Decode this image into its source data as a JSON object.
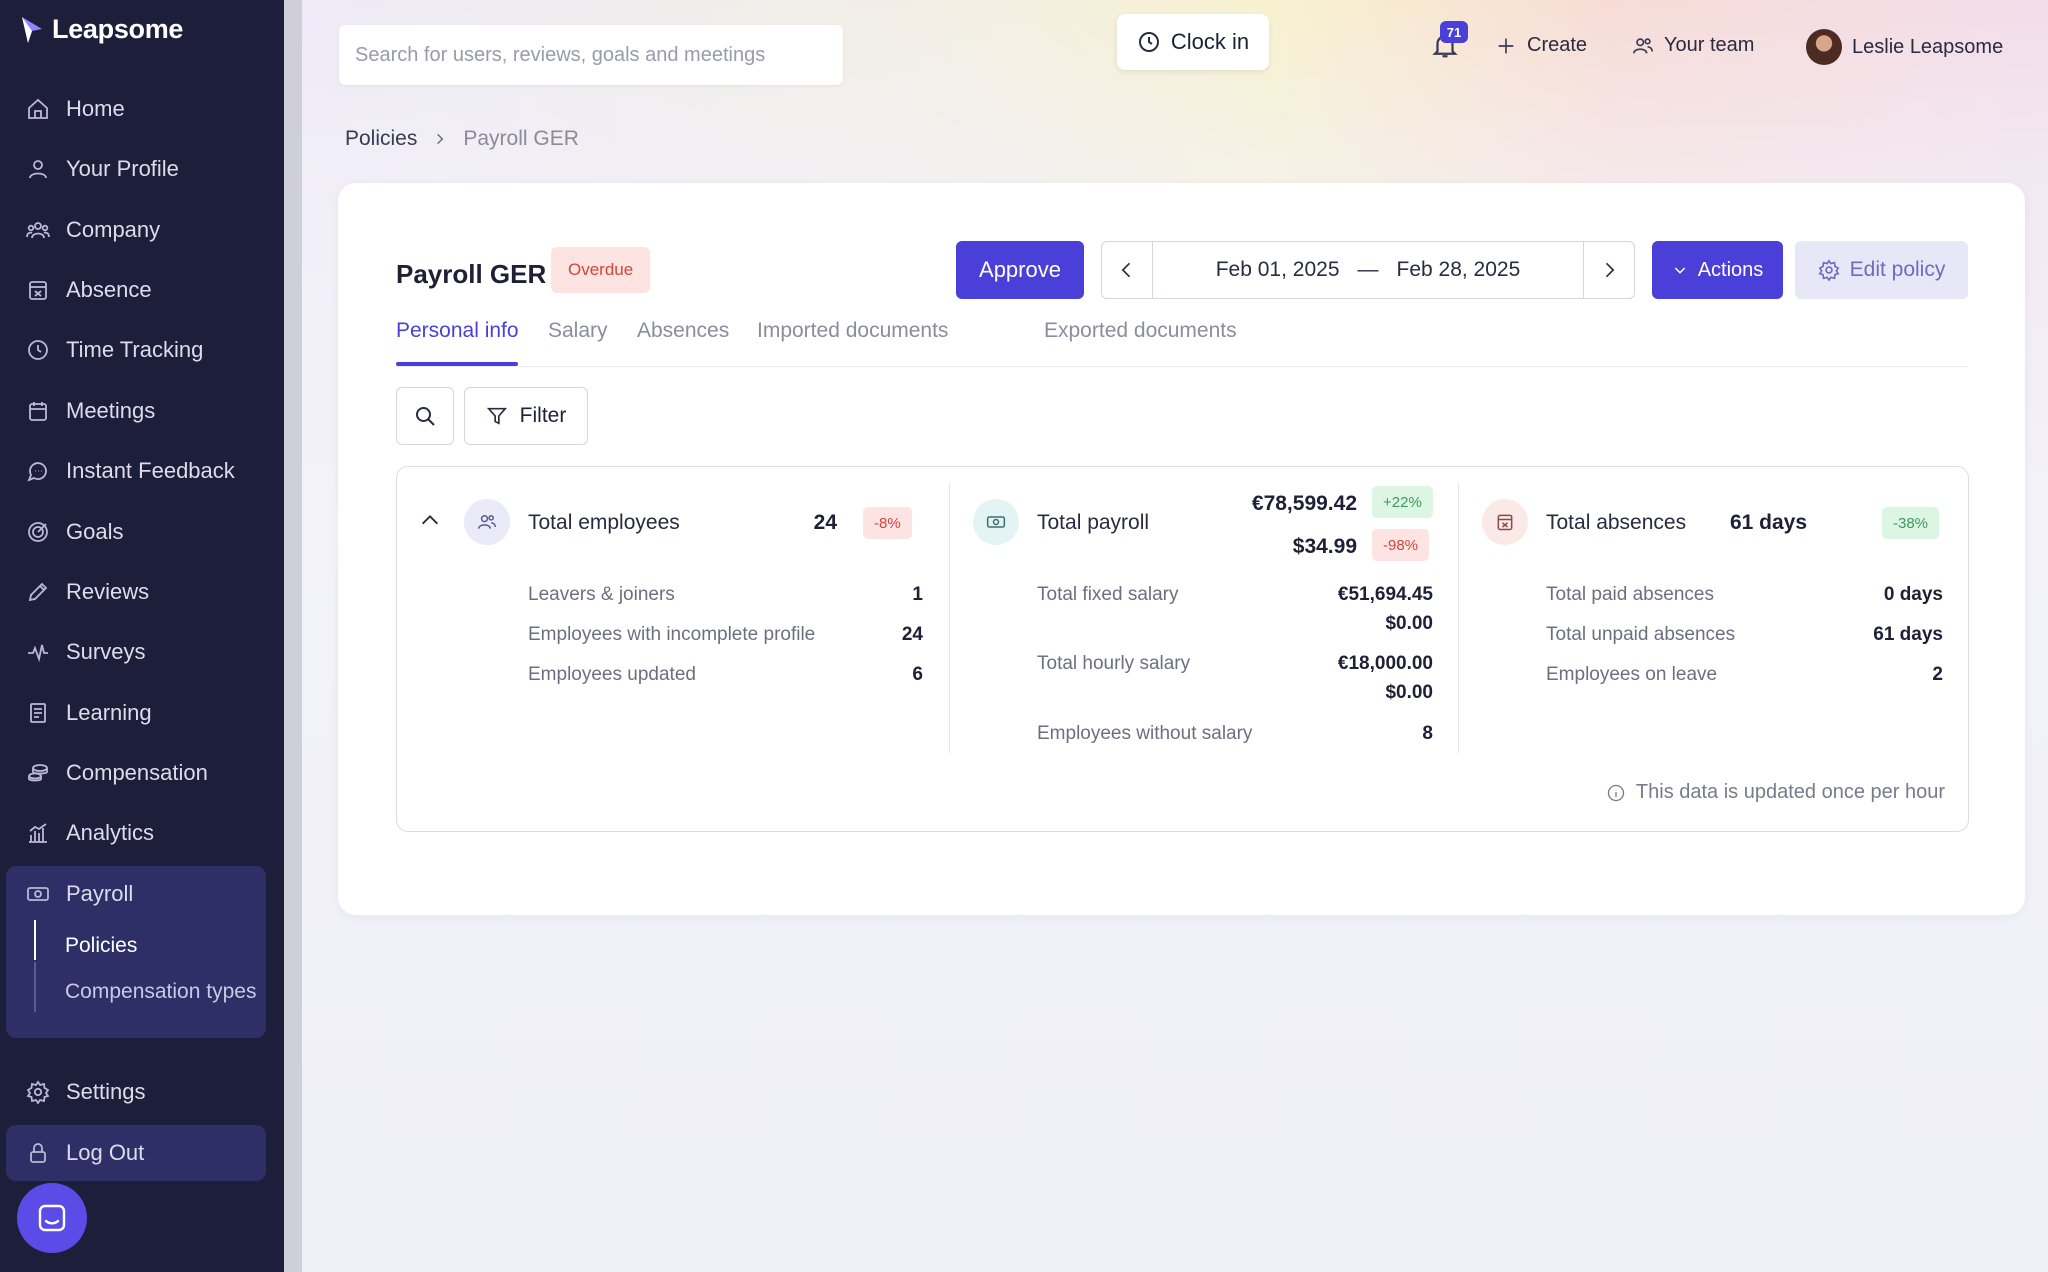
{
  "app": {
    "brand": "Leapsome"
  },
  "sidebar": {
    "items": [
      {
        "label": "Home",
        "icon": "home-icon"
      },
      {
        "label": "Your Profile",
        "icon": "user-icon"
      },
      {
        "label": "Company",
        "icon": "company-icon"
      },
      {
        "label": "Absence",
        "icon": "calendar-x-icon"
      },
      {
        "label": "Time Tracking",
        "icon": "clock-icon"
      },
      {
        "label": "Meetings",
        "icon": "calendar-icon"
      },
      {
        "label": "Instant Feedback",
        "icon": "chat-icon"
      },
      {
        "label": "Goals",
        "icon": "target-icon"
      },
      {
        "label": "Reviews",
        "icon": "pencil-icon"
      },
      {
        "label": "Surveys",
        "icon": "pulse-icon"
      },
      {
        "label": "Learning",
        "icon": "book-icon"
      },
      {
        "label": "Compensation",
        "icon": "coins-icon"
      },
      {
        "label": "Analytics",
        "icon": "chart-icon"
      },
      {
        "label": "Payroll",
        "icon": "money-icon"
      }
    ],
    "payroll_sub": [
      {
        "label": "Policies",
        "active": true
      },
      {
        "label": "Compensation types",
        "active": false
      }
    ],
    "settings": "Settings",
    "logout": "Log Out"
  },
  "topbar": {
    "search_placeholder": "Search for users, reviews, goals and meetings",
    "clock_in": "Clock in",
    "notifications_count": "71",
    "create": "Create",
    "your_team": "Your team",
    "user_name": "Leslie Leapsome"
  },
  "breadcrumb": {
    "parent": "Policies",
    "current": "Payroll GER"
  },
  "policy": {
    "title": "Payroll GER",
    "status": "Overdue",
    "approve": "Approve",
    "date_start": "Feb 01, 2025",
    "date_sep": "—",
    "date_end": "Feb 28, 2025",
    "actions": "Actions",
    "edit_policy": "Edit policy"
  },
  "tabs": [
    "Personal info",
    "Salary",
    "Absences",
    "Imported documents",
    "Exported documents"
  ],
  "filter_label": "Filter",
  "stats": {
    "employees": {
      "title": "Total employees",
      "value": "24",
      "change": "-8%",
      "rows": [
        {
          "label": "Leavers & joiners",
          "value": "1"
        },
        {
          "label": "Employees with incomplete profile",
          "value": "24"
        },
        {
          "label": "Employees updated",
          "value": "6"
        }
      ]
    },
    "payroll": {
      "title": "Total payroll",
      "value_eur": "€78,599.42",
      "change_eur": "+22%",
      "value_usd": "$34.99",
      "change_usd": "-98%",
      "fixed_label": "Total fixed salary",
      "fixed_eur": "€51,694.45",
      "fixed_usd": "$0.00",
      "hourly_label": "Total hourly salary",
      "hourly_eur": "€18,000.00",
      "hourly_usd": "$0.00",
      "without_label": "Employees without salary",
      "without_value": "8"
    },
    "absences": {
      "title": "Total absences",
      "value": "61 days",
      "change": "-38%",
      "rows": [
        {
          "label": "Total paid absences",
          "value": "0 days"
        },
        {
          "label": "Total unpaid absences",
          "value": "61 days"
        },
        {
          "label": "Employees on leave",
          "value": "2"
        }
      ]
    },
    "footnote": "This data is updated once per hour"
  },
  "colors": {
    "accent": "#4a3fd9",
    "sidebar": "#1d1e3a",
    "negative": "#d1463b",
    "positive": "#3f9a5b"
  }
}
